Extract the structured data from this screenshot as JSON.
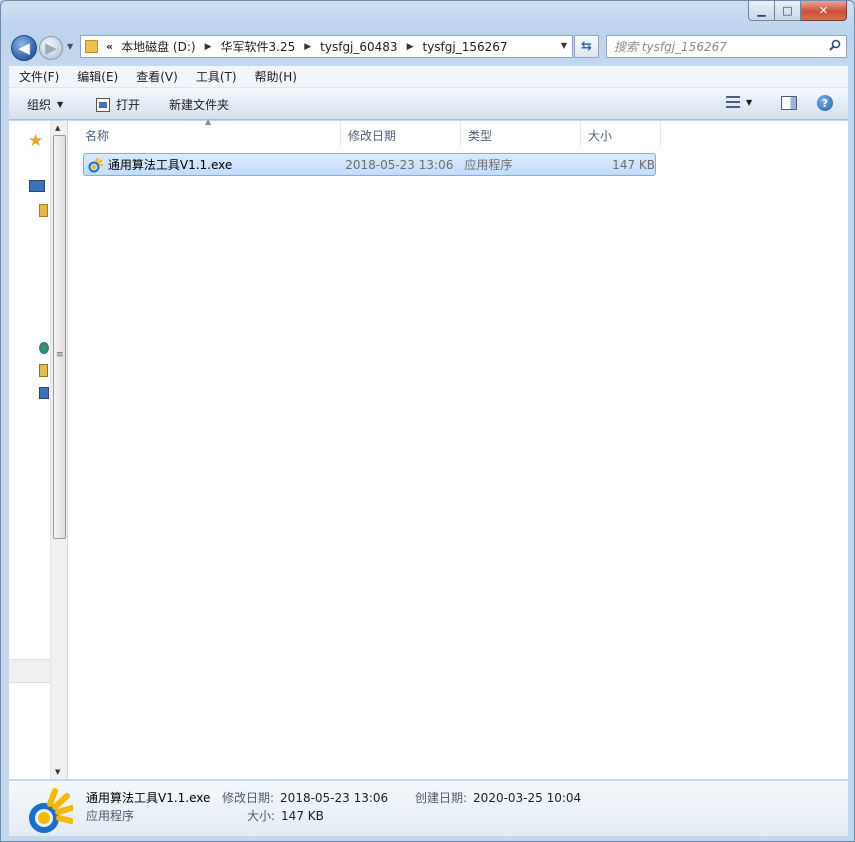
{
  "window": {
    "minimize_glyph": "▁",
    "maximize_glyph": "□",
    "close_glyph": "✕"
  },
  "address": {
    "overflow_glyph": "«",
    "crumbs": [
      "本地磁盘 (D:)",
      "华军软件3.25",
      "tysfgj_60483",
      "tysfgj_156267"
    ],
    "separator": "▶"
  },
  "search": {
    "placeholder": "搜索 tysfgj_156267"
  },
  "menu": [
    "文件(F)",
    "编辑(E)",
    "查看(V)",
    "工具(T)",
    "帮助(H)"
  ],
  "toolbar": {
    "organize_label": "组织",
    "open_label": "打开",
    "new_folder_label": "新建文件夹",
    "help_glyph": "?"
  },
  "columns": {
    "name": "名称",
    "date_modified": "修改日期",
    "type": "类型",
    "size": "大小"
  },
  "files": [
    {
      "name": "通用算法工具V1.1.exe",
      "date_modified": "2018-05-23 13:06",
      "type": "应用程序",
      "size": "147 KB"
    }
  ],
  "details": {
    "name": "通用算法工具V1.1.exe",
    "type": "应用程序",
    "modified_label": "修改日期:",
    "modified_value": "2018-05-23 13:06",
    "created_label": "创建日期:",
    "created_value": "2020-03-25 10:04",
    "size_label": "大小:",
    "size_value": "147 KB"
  },
  "colors": {
    "selection": "#cce4fc",
    "accent": "#2d5fa6",
    "icon_gold": "#f5b800",
    "icon_blue": "#1c6fc4"
  }
}
